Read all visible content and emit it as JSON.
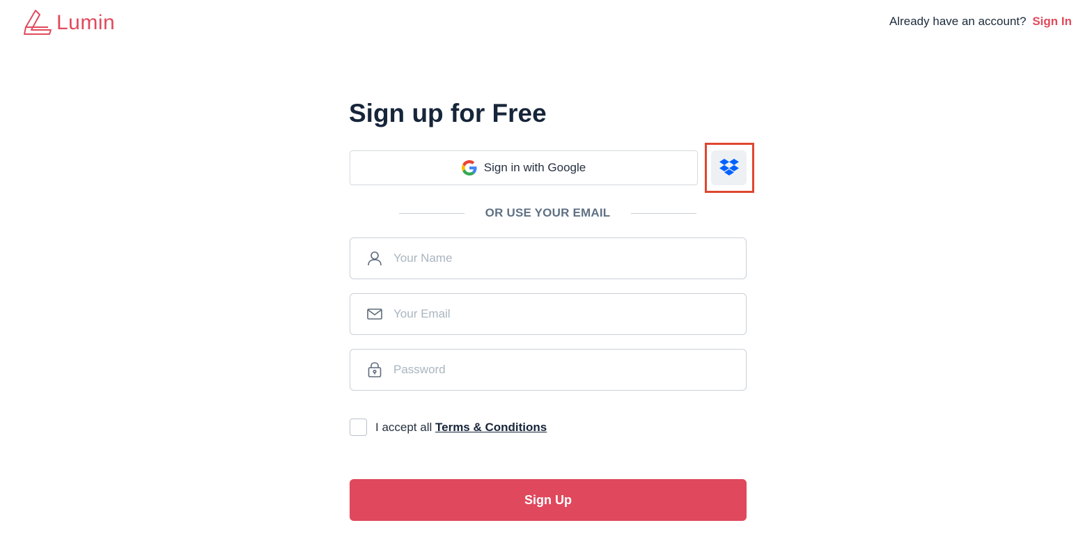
{
  "brand": {
    "name": "Lumin",
    "color": "#e14a5c"
  },
  "header": {
    "prompt": "Already have an account?",
    "signin_link": "Sign In"
  },
  "main": {
    "title": "Sign up for Free",
    "google_button": "Sign in with Google",
    "dropbox_button_icon": "dropbox-icon",
    "divider": "OR USE YOUR EMAIL",
    "name_placeholder": "Your Name",
    "email_placeholder": "Your Email",
    "password_placeholder": "Password",
    "terms_prefix": "I accept all",
    "terms_link": "Terms & Conditions",
    "submit": "Sign Up"
  },
  "colors": {
    "accent": "#e0485d",
    "highlight_frame": "#e0462f",
    "dropbox": "#0061fe"
  }
}
